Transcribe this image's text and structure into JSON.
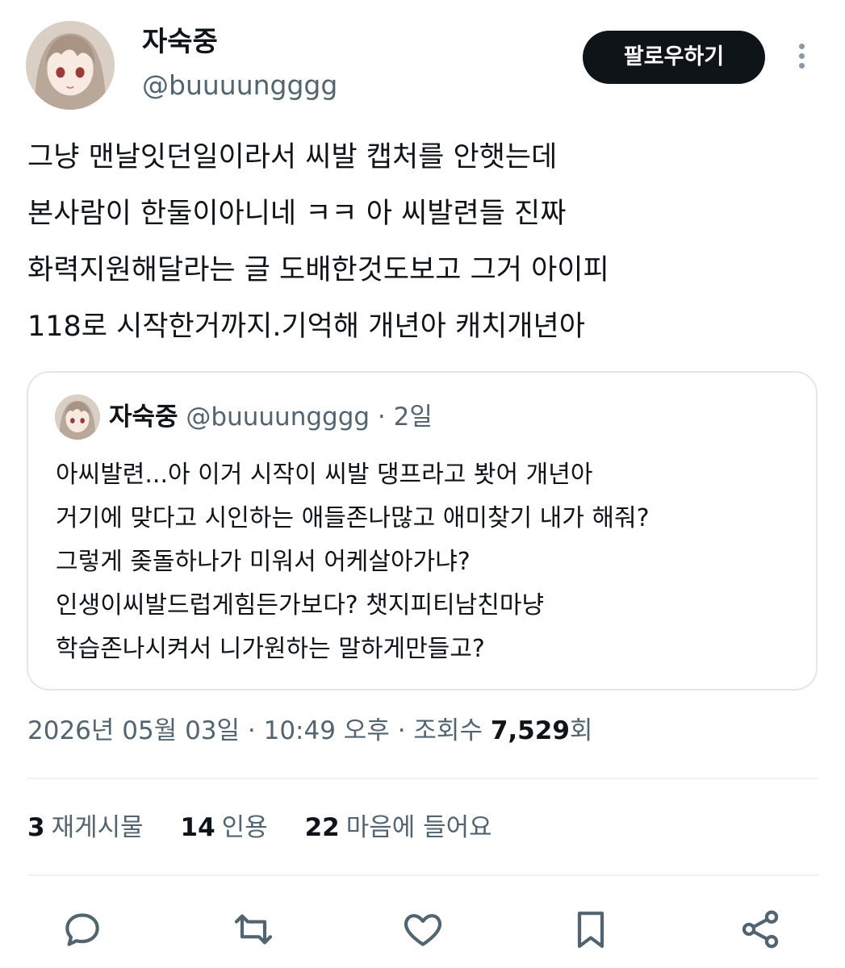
{
  "author": {
    "name": "자숙중",
    "handle": "@buuuungggg",
    "follow_label": "팔로우하기"
  },
  "tweet": {
    "lines": [
      "그냥 맨날잇던일이라서 씨발 캡처를 안햇는데",
      "본사람이 한둘이아니네 ㅋㅋ 아 씨발련들 진짜",
      "화력지원해달라는 글 도배한것도보고 그거 아이피",
      "118로 시작한거까지.기억해 개년아 캐치개년아"
    ]
  },
  "quote": {
    "name": "자숙중",
    "handle": "@buuuungggg",
    "separator": "·",
    "time": "2일",
    "lines": [
      "아씨발련...아 이거 시작이 씨발 댕프라고 봣어 개년아",
      "거기에 맞다고 시인하는 애들존나많고 애미찾기 내가 해줘?",
      "그렇게 좆돌하나가 미워서 어케살아가냐?",
      "인생이씨발드럽게힘든가보다? 챗지피티남친마냥",
      "학습존나시켜서 니가원하는 말하게만들고?"
    ]
  },
  "meta": {
    "date_time": "2026년 05월 03일 · 10:49 오후 · 조회수 ",
    "views": "7,529",
    "views_suffix": "회"
  },
  "stats": {
    "reposts_count": "3",
    "reposts_label": "재게시물",
    "quotes_count": "14",
    "quotes_label": "인용",
    "likes_count": "22",
    "likes_label": "마음에 들어요"
  },
  "colors": {
    "primary_text": "#0f1419",
    "secondary_text": "#536471",
    "border": "#e1e8ed",
    "icon": "#536471"
  },
  "icons": [
    "reply-icon",
    "repost-icon",
    "like-icon",
    "bookmark-icon",
    "share-icon",
    "more-icon"
  ]
}
